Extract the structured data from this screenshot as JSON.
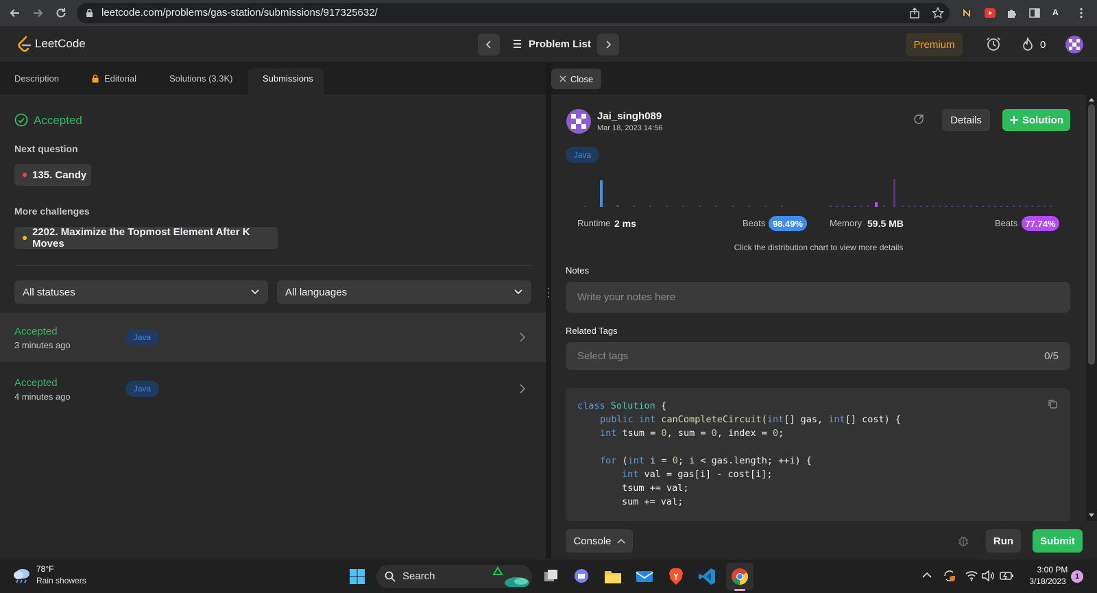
{
  "browser": {
    "url": "leetcode.com/problems/gas-station/submissions/917325632/",
    "profile_initial": "A"
  },
  "navbar": {
    "logo_text": "LeetCode",
    "problem_list_label": "Problem List",
    "premium_label": "Premium",
    "streak_count": "0"
  },
  "left_tabs": {
    "description": "Description",
    "editorial": "Editorial",
    "solutions": "Solutions (3.3K)",
    "submissions": "Submissions"
  },
  "result": {
    "status": "Accepted",
    "next_question_label": "Next question",
    "next_question": "135. Candy",
    "more_challenges_label": "More challenges",
    "more_challenge": "2202. Maximize the Topmost Element After K Moves"
  },
  "filters": {
    "status": "All statuses",
    "language": "All languages"
  },
  "submissions": [
    {
      "status": "Accepted",
      "time": "3 minutes ago",
      "language": "Java"
    },
    {
      "status": "Accepted",
      "time": "4 minutes ago",
      "language": "Java"
    }
  ],
  "right_panel": {
    "close_label": "Close",
    "username": "Jai_singh089",
    "date": "Mar 18, 2023 14:56",
    "details_label": "Details",
    "solution_label": "Solution",
    "language_tag": "Java",
    "runtime_label": "Runtime",
    "runtime_value": "2 ms",
    "runtime_beats_label": "Beats",
    "runtime_beats": "98.49%",
    "memory_label": "Memory",
    "memory_value": "59.5 MB",
    "memory_beats_label": "Beats",
    "memory_beats": "77.74%",
    "chart_hint": "Click the distribution chart to view more details",
    "notes_label": "Notes",
    "notes_placeholder": "Write your notes here",
    "tags_label": "Related Tags",
    "tags_placeholder": "Select tags",
    "tags_count": "0/5"
  },
  "code": {
    "line1": "class Solution {",
    "line2": "public int canCompleteCircuit(int[] gas, int[] cost) {",
    "line3": "int tsum = 0, sum = 0, index = 0;",
    "line4": "for (int i = 0; i < gas.length; ++i) {",
    "line5": "int val = gas[i] - cost[i];",
    "line6": "tsum += val;",
    "line7": "sum += val;"
  },
  "bottom_bar": {
    "console_label": "Console",
    "run_label": "Run",
    "submit_label": "Submit"
  },
  "taskbar": {
    "temperature": "78°F",
    "weather": "Rain showers",
    "search_label": "Search",
    "time": "3:00 PM",
    "date": "3/18/2023",
    "notification_count": "1"
  },
  "colors": {
    "accepted_green": "#2cbb5d",
    "brand_orange": "#ffa116",
    "runtime_blue": "#3b8eea",
    "memory_purple": "#b24bf3"
  }
}
